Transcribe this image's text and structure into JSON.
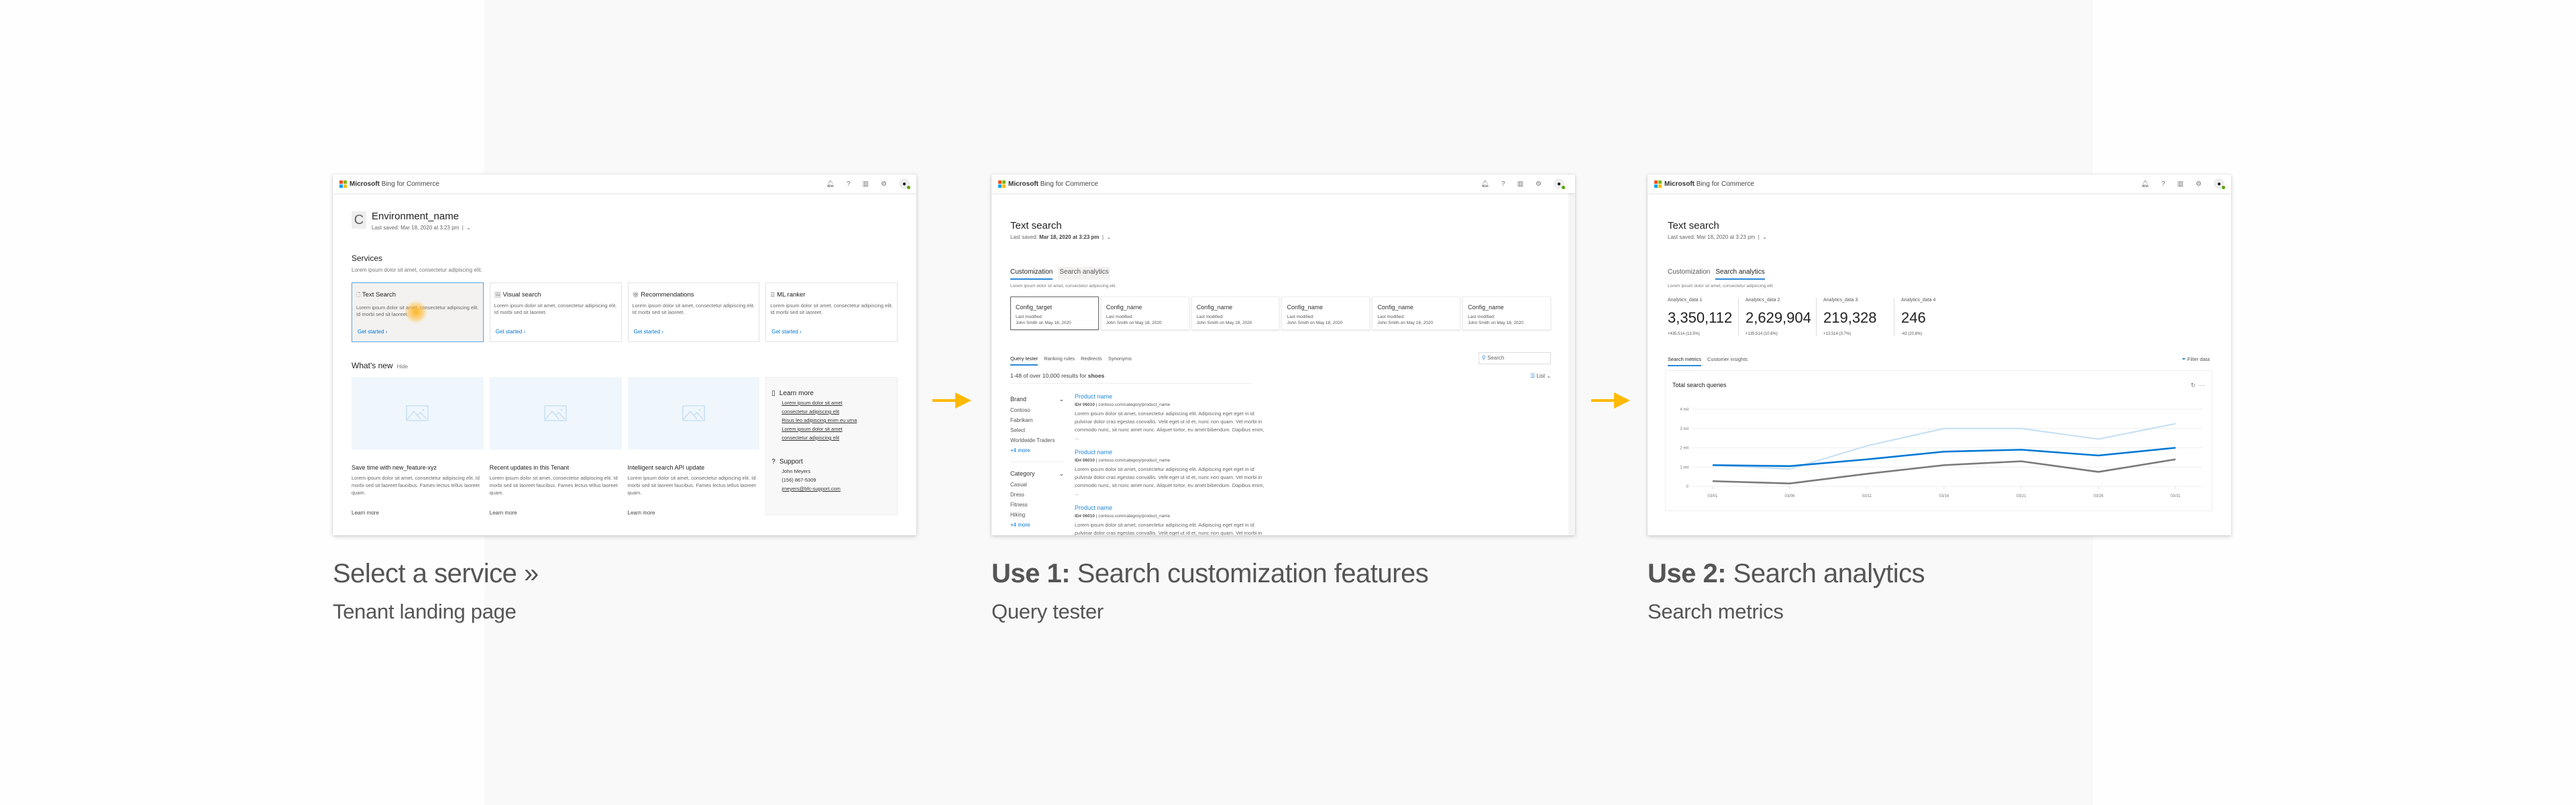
{
  "app": {
    "brand_bold": "Microsoft",
    "brand_rest": "Bing for Commerce",
    "logo_colors": [
      "#f25022",
      "#7fba00",
      "#00a4ef",
      "#ffb900"
    ],
    "header_icons": [
      "bell-icon",
      "help-icon",
      "book-icon",
      "gear-icon",
      "user-avatar"
    ]
  },
  "colors": {
    "accent": "#0078d4",
    "arrow": "#ffb900",
    "band_bg": "#f9f9f9"
  },
  "screen1": {
    "env_initial": "C",
    "env_name": "Environment_name",
    "last_saved_label": "Last saved: Mar 18, 2020 at 3:23 pm",
    "services_title": "Services",
    "services_desc": "Lorem ipsum dolor sit amet, consectetur adipiscing elit.",
    "services": [
      {
        "title": "Text Search",
        "icon": "document-search-icon",
        "desc": "Lorem ipsum dolor sit amet, consectetur adipiscing elit. Id morbi sed sit laoreet.",
        "cta": "Get started",
        "selected": true
      },
      {
        "title": "Visual search",
        "icon": "image-search-icon",
        "desc": "Lorem ipsum dolor sit amet, consectetur adipiscing elit. Id morbi sed sit laoreet.",
        "cta": "Get started",
        "selected": false
      },
      {
        "title": "Recommendations",
        "icon": "gift-icon",
        "desc": "Lorem ipsum dolor sit amet, consectetur adipiscing elit. Id morbi sed sit laoreet.",
        "cta": "Get started",
        "selected": false
      },
      {
        "title": "ML ranker",
        "icon": "list-rank-icon",
        "desc": "Lorem ipsum dolor sit amet, consectetur adipiscing elit. Id morbi sed sit laoreet.",
        "cta": "Get started",
        "selected": false
      }
    ],
    "whats_new_title": "What's new",
    "hide_label": "Hide",
    "news": [
      {
        "title": "Save time with new_feature-xyz",
        "desc": "Lorem ipsum dolor sit amet, consectetur adipiscing elit. Id morbi sed sit laoreet faucibus. Fames lectus tellus laoreet quam.",
        "cta": "Learn more"
      },
      {
        "title": "Recent updates in this Tenant",
        "desc": "Lorem ipsum dolor sit amet, consectetur adipiscing elit. Id morbi sed sit laoreet faucibus. Fames lectus tellus laoreet quam.",
        "cta": "Learn more"
      },
      {
        "title": "Intelligent search API update",
        "desc": "Lorem ipsum dolor sit amet, consectetur adipiscing elit. Id morbi sed sit laoreet faucibus. Fames lectus tellus laoreet quam.",
        "cta": "Learn more"
      }
    ],
    "learn_more": {
      "title": "Learn more",
      "links": [
        "Lorem ipsum dolor sit amet",
        "consectetur adipiscing elit",
        "Risus leo adipiscing enim eu urna",
        "Lorem ipsum dolor sit amet",
        "consectetur adipiscing elit"
      ]
    },
    "support": {
      "title": "Support",
      "name": "John Meyers",
      "phone": "(156) 867-5309",
      "email": "jmeyers@bfc-support.com"
    }
  },
  "screen2": {
    "title": "Text search",
    "last_saved_prefix": "Last saved: ",
    "last_saved_value": "Mar 18, 2020 at 3:23 pm",
    "tabs": [
      {
        "label": "Customization",
        "active": true
      },
      {
        "label": "Search analytics",
        "active": false
      }
    ],
    "tab_desc": "Lorem ipsum dolor sit amet, consectetur adipiscing elit.",
    "configs": [
      {
        "name": "Config_target",
        "modified_label": "Last modified:",
        "modified_by": "John Smith on May 18, 2020",
        "active": true
      },
      {
        "name": "Config_name",
        "modified_label": "Last modified:",
        "modified_by": "John Smith on May 18, 2020",
        "active": false
      },
      {
        "name": "Config_name",
        "modified_label": "Last modified:",
        "modified_by": "John Smith on May 18, 2020",
        "active": false
      },
      {
        "name": "Config_name",
        "modified_label": "Last modified:",
        "modified_by": "John Smith on May 18, 2020",
        "active": false
      },
      {
        "name": "Config_name",
        "modified_label": "Last modified:",
        "modified_by": "John Smith on May 18, 2020",
        "active": false
      },
      {
        "name": "Config_name",
        "modified_label": "Last modified:",
        "modified_by": "John Smith on May 18, 2020",
        "active": false
      }
    ],
    "subtabs": [
      {
        "label": "Query tester",
        "active": true
      },
      {
        "label": "Ranking rules",
        "active": false
      },
      {
        "label": "Redirects",
        "active": false
      },
      {
        "label": "Synonyms",
        "active": false
      }
    ],
    "search_placeholder": "Search",
    "results_prefix": "1-48 of over 10,000 results for ",
    "results_query": "shoes",
    "view_label": "List",
    "facets": [
      {
        "title": "Brand",
        "items": [
          "Contoso",
          "Fabrikam",
          "Select",
          "Worldwide Traders"
        ],
        "more": "+4 more"
      },
      {
        "title": "Category",
        "items": [
          "Casual",
          "Dress",
          "Fitness",
          "Hiking"
        ],
        "more": "+4 more"
      }
    ],
    "results": [
      {
        "name": "Product name",
        "id": "ID# 06010",
        "url": "contoso.com/category/product_name",
        "desc": "Lorem ipsum dolor sit amet, consectetur adipiscing elit. Adipiscing eget eget in id pulvinar dolor cras egestas convallis. Velit eget ut id et, nunc non quam. Vel morbi in commodo nunc, sit nunc amet nunc. Aliquet tortor, eu amet bibendum. Dapibus enim, ..."
      },
      {
        "name": "Product name",
        "id": "ID# 06010",
        "url": "contoso.com/category/product_name",
        "desc": "Lorem ipsum dolor sit amet, consectetur adipiscing elit. Adipiscing eget eget in id pulvinar dolor cras egestas convallis. Velit eget ut id et, nunc non quam. Vel morbi in commodo nunc, sit nunc amet nunc. Aliquet tortor, eu amet bibendum. Dapibus enim, ..."
      },
      {
        "name": "Product name",
        "id": "ID# 06010",
        "url": "contoso.com/category/product_name",
        "desc": "Lorem ipsum dolor sit amet, consectetur adipiscing elit. Adipiscing eget eget in id pulvinar dolor cras egestas convallis. Velit eget ut id et, nunc non quam. Vel morbi in commodo nunc, sit nunc amet nunc. Aliquet tortor, eu amet bibendum. Dapibus enim, ..."
      }
    ]
  },
  "screen3": {
    "title": "Text search",
    "last_saved_label": "Last saved: Mar 18, 2020 at 3:23 pm",
    "tabs": [
      {
        "label": "Customization",
        "active": false
      },
      {
        "label": "Search analytics",
        "active": true
      }
    ],
    "tab_desc": "Lorem ipsum dolor sit amet, consectetur adipiscing elit.",
    "kpis": [
      {
        "label": "Analytics_data 1",
        "value": "3,350,112",
        "change": "+435,514 (13.5%)"
      },
      {
        "label": "Analytics_data 2",
        "value": "2,629,904",
        "change": "+135,514 (10.6%)"
      },
      {
        "label": "Analytics_data 3",
        "value": "219,328",
        "change": "+13,514 (3.7%)"
      },
      {
        "label": "Analytics_data 4",
        "value": "246",
        "change": "-43 (20.8%)"
      }
    ],
    "subtabs": [
      {
        "label": "Search metrics",
        "active": true
      },
      {
        "label": "Customer insights",
        "active": false
      }
    ],
    "filter_label": "Filter data",
    "chart_title": "Total search queries"
  },
  "chart_data": {
    "type": "line",
    "title": "Total search queries",
    "x": [
      "03/01",
      "03/06",
      "03/11",
      "03/16",
      "03/21",
      "03/26",
      "03/31"
    ],
    "y_ticks": [
      "0",
      "1 mil",
      "2 mil",
      "3 mil",
      "4 mil"
    ],
    "ylim": [
      0,
      4
    ],
    "yunit": "million",
    "grid": true,
    "series": [
      {
        "name": "series-light",
        "color": "#c7e0f4",
        "values": [
          1.1,
          0.9,
          2.1,
          3.0,
          3.0,
          2.45,
          3.25
        ]
      },
      {
        "name": "series-blue",
        "color": "#0078d4",
        "values": [
          1.1,
          1.05,
          1.4,
          1.8,
          1.9,
          1.6,
          2.0
        ]
      },
      {
        "name": "series-gray",
        "color": "#7a7a7a",
        "values": [
          0.27,
          0.15,
          0.65,
          1.1,
          1.3,
          0.75,
          1.4
        ]
      }
    ]
  },
  "captions": [
    {
      "bold": "",
      "title": "Select a service »",
      "sub": "Tenant landing page"
    },
    {
      "bold": "Use 1:",
      "title": " Search customization features",
      "sub": "Query tester"
    },
    {
      "bold": "Use 2:",
      "title": " Search analytics",
      "sub": "Search metrics"
    }
  ]
}
